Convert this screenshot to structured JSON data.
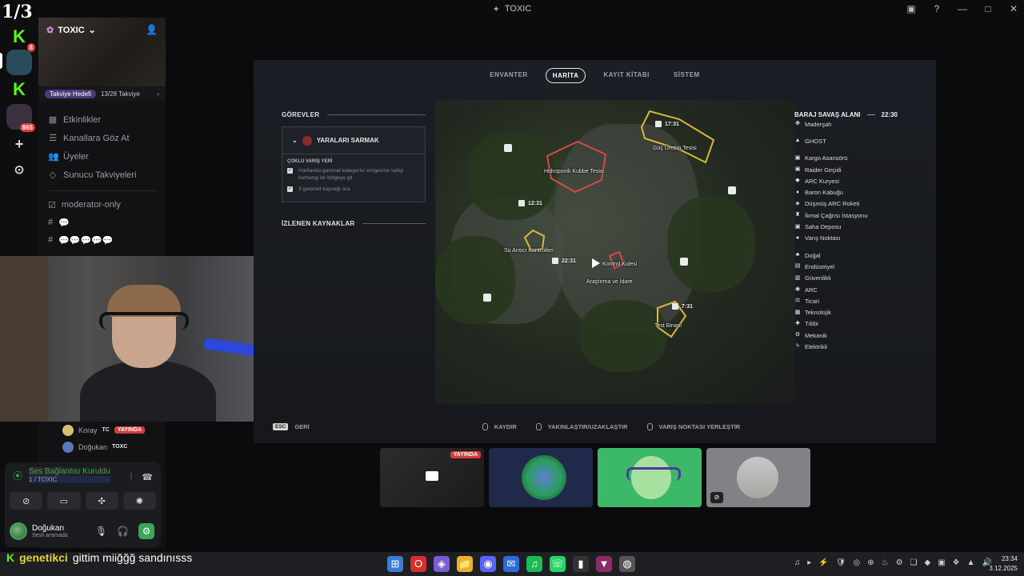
{
  "overlay": {
    "counter": "1/3"
  },
  "window": {
    "title": "TOXIC",
    "controls": [
      "▣",
      "?",
      "—",
      "□",
      "✕"
    ]
  },
  "rail": {
    "servers": [
      {
        "letter": "K",
        "badge": "8",
        "color": "#53fc18"
      },
      {
        "letter": "",
        "badge": "",
        "color": "#2b6a4a"
      },
      {
        "letter": "K",
        "badge": "",
        "color": "#53fc18"
      },
      {
        "letter": "",
        "badge": "865",
        "color": "#8a3a5a"
      }
    ],
    "add_icon": "+",
    "discover_icon": "⊙"
  },
  "server": {
    "name": "TOXIC",
    "boost_goal": "Takviye Hedefi",
    "boost_count": "13/28 Takviye",
    "nav": [
      {
        "icon": "▦",
        "label": "Etkinlikler"
      },
      {
        "icon": "☰",
        "label": "Kanallara Göz At"
      },
      {
        "icon": "👥",
        "label": "Üyeler"
      },
      {
        "icon": "◇",
        "label": "Sunucu Takviyeleri"
      }
    ],
    "channels": [
      {
        "icon": "☑",
        "label": "moderator-only"
      },
      {
        "icon": "#",
        "label": "💬"
      },
      {
        "icon": "#",
        "label": "💬💬💬💬💬"
      }
    ]
  },
  "voice_users": [
    {
      "name": "Koray",
      "tag": "TC",
      "live": "YAYINDA",
      "color": "#d8c070"
    },
    {
      "name": "Doğukan",
      "tag": "TOXC",
      "live": "",
      "color": "#5c78b8"
    }
  ],
  "voice_panel": {
    "status": "Ses Bağlantısı Kuruldu",
    "channel": "1 / TOXIC",
    "buttons": [
      "⊘",
      "▭",
      "✣",
      "✺"
    ],
    "user_name": "Doğukan",
    "user_status": "Sesli aramada",
    "controls": [
      "🎙",
      "🎧",
      "⚙"
    ]
  },
  "game": {
    "tabs": [
      "ENVANTER",
      "HARİTA",
      "KAYIT KİTABI",
      "SİSTEM"
    ],
    "active_tab": "HARİTA",
    "tasks_title": "GÖREVLER",
    "quest_title": "YARALARI SARMAK",
    "quest_section": "ÇOKLU VARIŞ YERİ",
    "objectives": [
      "Haritanda ganimet kategorisi simgesine sahip herhangi bir bölgeye git",
      "3 ganimet kaynağı ara"
    ],
    "tracked_title": "İZLENEN KAYNAKLAR",
    "map_labels": [
      {
        "text": "Hidroponik Kubbe Tesisi"
      },
      {
        "text": "Güç Üretim Tesisi"
      },
      {
        "text": "Su Arıtıcı Kontrolleri"
      },
      {
        "text": "Kontrol Kulesi"
      },
      {
        "text": "Araştırma ve İdare"
      },
      {
        "text": "Test Binası"
      }
    ],
    "map_timers": [
      "17:31",
      "12:31",
      "22:31",
      "7:31"
    ],
    "legend_title": "BARAJ SAVAŞ ALANI",
    "legend_time": "22:30",
    "legend_group1": [
      {
        "icon": "✤",
        "label": "Maderşah"
      }
    ],
    "legend_group2": [
      {
        "icon": "▲",
        "label": "GHOST"
      }
    ],
    "legend_group3": [
      {
        "icon": "▣",
        "label": "Kargo Asansörü"
      },
      {
        "icon": "▣",
        "label": "Raider Geçidi"
      },
      {
        "icon": "◆",
        "label": "ARC Kuryesi"
      },
      {
        "icon": "♦",
        "label": "Baron Kabuğu"
      },
      {
        "icon": "◈",
        "label": "Düşmüş ARC Roketi"
      },
      {
        "icon": "♜",
        "label": "İkmal Çağrısı İstasyonu"
      },
      {
        "icon": "▣",
        "label": "Saha Deposu"
      },
      {
        "icon": "●",
        "label": "Varış Noktası"
      }
    ],
    "legend_group4": [
      {
        "icon": "♣",
        "label": "Doğal"
      },
      {
        "icon": "▤",
        "label": "Endüstriyel"
      },
      {
        "icon": "▥",
        "label": "Güvenlikli"
      },
      {
        "icon": "◉",
        "label": "ARC"
      },
      {
        "icon": "⚖",
        "label": "Ticari"
      },
      {
        "icon": "▦",
        "label": "Teknolojik"
      },
      {
        "icon": "✚",
        "label": "Tıbbi"
      },
      {
        "icon": "⚙",
        "label": "Mekanik"
      },
      {
        "icon": "ϟ",
        "label": "Elektrikli"
      }
    ],
    "footer": {
      "esc_key": "ESC",
      "back": "GERİ",
      "pan": "KAYDIR",
      "zoom": "YAKINLAŞTIR/UZAKLAŞTIR",
      "waypoint": "VARIŞ NOKTASI YERLEŞTİR"
    }
  },
  "tiles": {
    "live": "YAYINDA"
  },
  "chat": {
    "platform": "K",
    "user": "genetikci",
    "message": "gittim miiğğğ sandınısss"
  },
  "taskbar": {
    "apps": [
      "⊞",
      "O",
      "◈",
      "📁",
      "◉",
      "✉",
      "♫",
      "☏",
      "▮",
      "▼",
      "◍"
    ],
    "tray": [
      "♫",
      "▸",
      "⚡",
      "🛡",
      "◎",
      "⊕",
      "♨",
      "⚙",
      "❏",
      "◆",
      "▣",
      "❖",
      "▲",
      "🔊"
    ],
    "time": "23:34",
    "date": "3.12.2025"
  }
}
